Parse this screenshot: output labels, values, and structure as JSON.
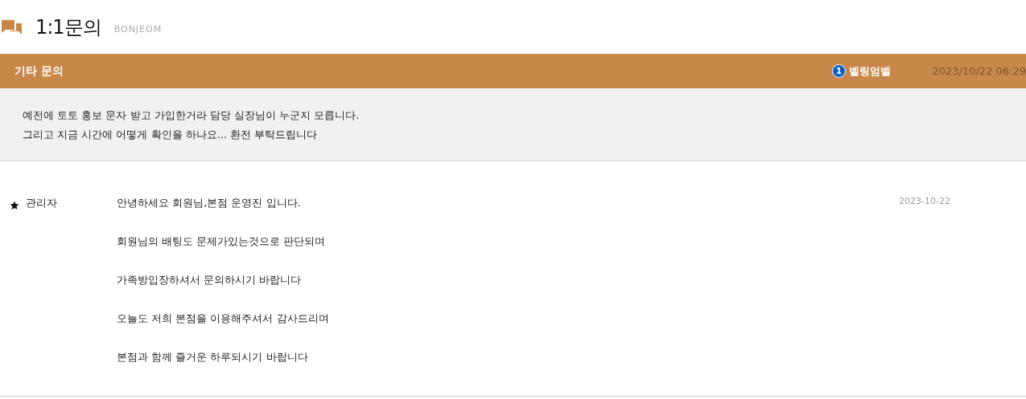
{
  "page": {
    "title": "1:1문의",
    "subtitle": "BONJEOM"
  },
  "inquiry": {
    "category": "기타 문의",
    "user_level": "1",
    "user_name": "벨링엄벨",
    "datetime": "2023/10/22 06:29",
    "body": [
      "예전에 토토 홍보 문자 받고 가입한거라 담당 실장님이 누군지 모릅니다.",
      "그리고 지금 시간에 어떻게 확인을 하나요... 환전 부탁드립니다"
    ]
  },
  "reply": {
    "author": "관리자",
    "date": "2023-10-22",
    "lines": [
      "안녕하세요 회원님,본점 운영진 입니다.",
      "회원님의 배팅도 문제가있는것으로 판단되며",
      "가족방입장하셔서 문의하시기 바랍니다",
      "오늘도 저희 본점을 이용해주셔서 감사드리며",
      "본점과 함께 즐거운 하루되시기 바랍니다"
    ]
  }
}
